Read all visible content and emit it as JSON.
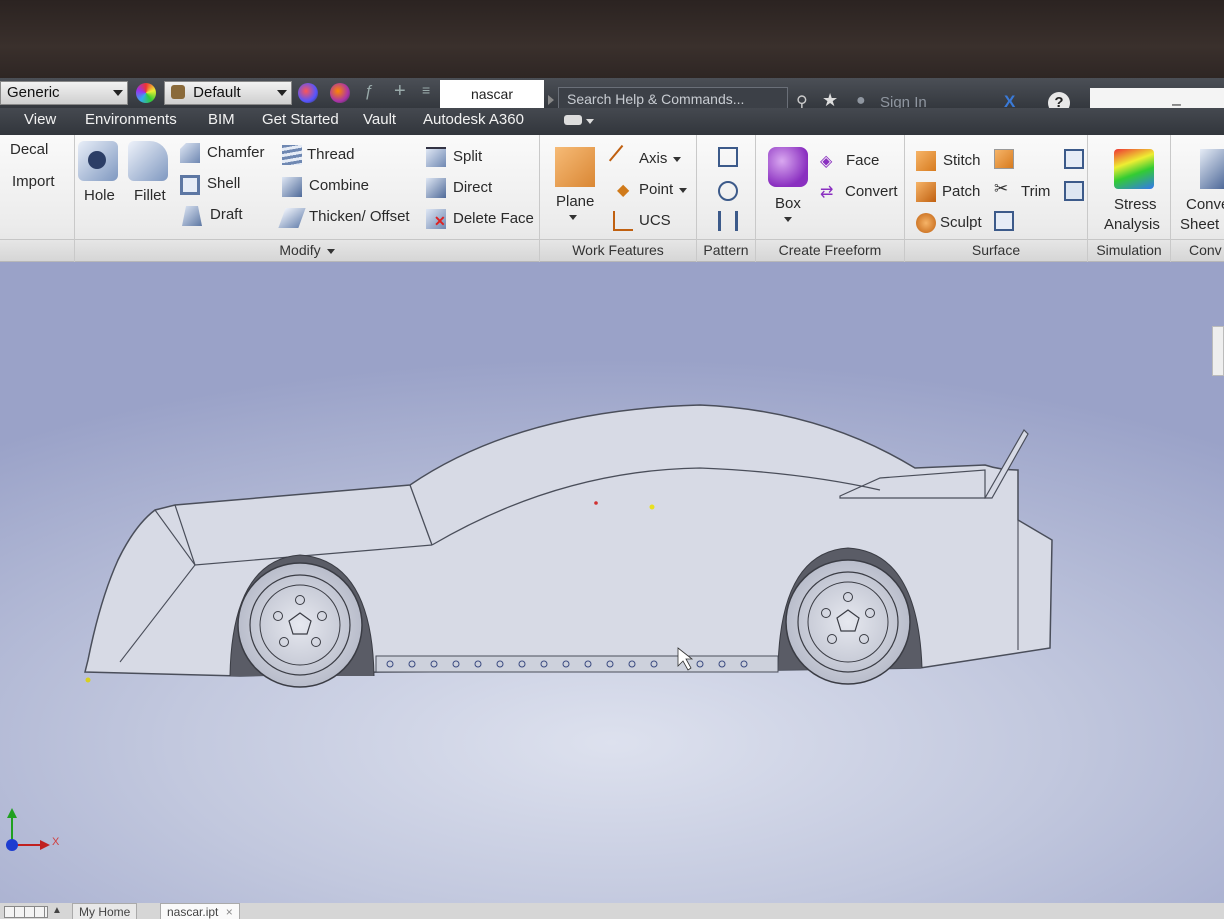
{
  "quick_access": {
    "appearance_value": "Generic",
    "material_value": "Default",
    "document_tab": "nascar",
    "search_placeholder": "Search Help & Commands...",
    "sign_in": "Sign In",
    "help": "?",
    "minimize": "–"
  },
  "menu": [
    "View",
    "Environments",
    "BIM",
    "Get Started",
    "Vault",
    "Autodesk A360"
  ],
  "ribbon": {
    "insert": {
      "decal": "Decal",
      "import": "Import"
    },
    "modify": {
      "hole": "Hole",
      "fillet": "Fillet",
      "chamfer": "Chamfer",
      "shell": "Shell",
      "draft": "Draft",
      "thread": "Thread",
      "combine": "Combine",
      "thicken": "Thicken/ Offset",
      "split": "Split",
      "direct": "Direct",
      "delete_face": "Delete Face",
      "label": "Modify"
    },
    "work_features": {
      "plane": "Plane",
      "axis": "Axis",
      "point": "Point",
      "ucs": "UCS",
      "label": "Work Features"
    },
    "pattern": {
      "label": "Pattern"
    },
    "freeform": {
      "box": "Box",
      "face": "Face",
      "convert": "Convert",
      "label": "Create Freeform"
    },
    "surface": {
      "stitch": "Stitch",
      "patch": "Patch",
      "trim": "Trim",
      "sculpt": "Sculpt",
      "label": "Surface"
    },
    "simulation": {
      "stress": "Stress",
      "analysis": "Analysis",
      "label": "Simulation"
    },
    "convert": {
      "line1": "Conve",
      "line2": "Sheet M",
      "label": "Conv"
    }
  },
  "viewport": {
    "axis_x_label": "X"
  },
  "status": {
    "home_tab": "My Home",
    "file_tab": "nascar.ipt"
  },
  "colors": {
    "accent": "#1f6fd1",
    "viewport_bg": "#c2c8de",
    "ribbon_bg": "#ececec"
  }
}
